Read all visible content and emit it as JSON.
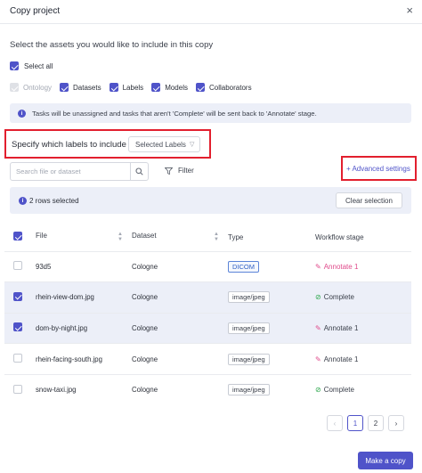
{
  "dialog": {
    "title": "Copy project",
    "close_icon": "×"
  },
  "intro": "Select the assets you would like to include in this copy",
  "select_all": {
    "label": "Select all",
    "checked": true
  },
  "assets": [
    {
      "label": "Ontology",
      "checked": true,
      "disabled": true
    },
    {
      "label": "Datasets",
      "checked": true,
      "disabled": false
    },
    {
      "label": "Labels",
      "checked": true,
      "disabled": false
    },
    {
      "label": "Models",
      "checked": true,
      "disabled": false
    },
    {
      "label": "Collaborators",
      "checked": true,
      "disabled": false
    }
  ],
  "info": "Tasks will be unassigned and tasks that aren't 'Complete' will be sent back to 'Annotate' stage.",
  "labels_option": {
    "label": "Specify which labels to include",
    "selected": "Selected Labels"
  },
  "search": {
    "placeholder": "Search file or dataset"
  },
  "filter_label": "Filter",
  "advanced_settings": "+ Advanced settings",
  "selection": {
    "text": "2 rows selected",
    "clear_label": "Clear selection"
  },
  "table": {
    "headers": [
      "File",
      "Dataset",
      "Type",
      "Workflow stage"
    ],
    "rows": [
      {
        "file": "93d5",
        "dataset": "Cologne",
        "type": "DICOM",
        "stage": "Annotate 1",
        "stage_kind": "annotate",
        "selected": false
      },
      {
        "file": "rhein-view-dom.jpg",
        "dataset": "Cologne",
        "type": "image/jpeg",
        "stage": "Complete",
        "stage_kind": "complete",
        "selected": true
      },
      {
        "file": "dom-by-night.jpg",
        "dataset": "Cologne",
        "type": "image/jpeg",
        "stage": "Annotate 1",
        "stage_kind": "annotate",
        "selected": true
      },
      {
        "file": "rhein-facing-south.jpg",
        "dataset": "Cologne",
        "type": "image/jpeg",
        "stage": "Annotate 1",
        "stage_kind": "annotate",
        "selected": false
      },
      {
        "file": "snow-taxi.jpg",
        "dataset": "Cologne",
        "type": "image/jpeg",
        "stage": "Complete",
        "stage_kind": "complete",
        "selected": false
      }
    ]
  },
  "pagination": {
    "prev": "‹",
    "pages": [
      "1",
      "2"
    ],
    "current": "1",
    "next": "›"
  },
  "make_copy_label": "Make a copy",
  "colors": {
    "accent": "#4f53c9",
    "highlight_border": "#e21f2e",
    "info_bg": "#eceff8",
    "complete": "#2fa84f",
    "annotate": "#e04b8b"
  }
}
